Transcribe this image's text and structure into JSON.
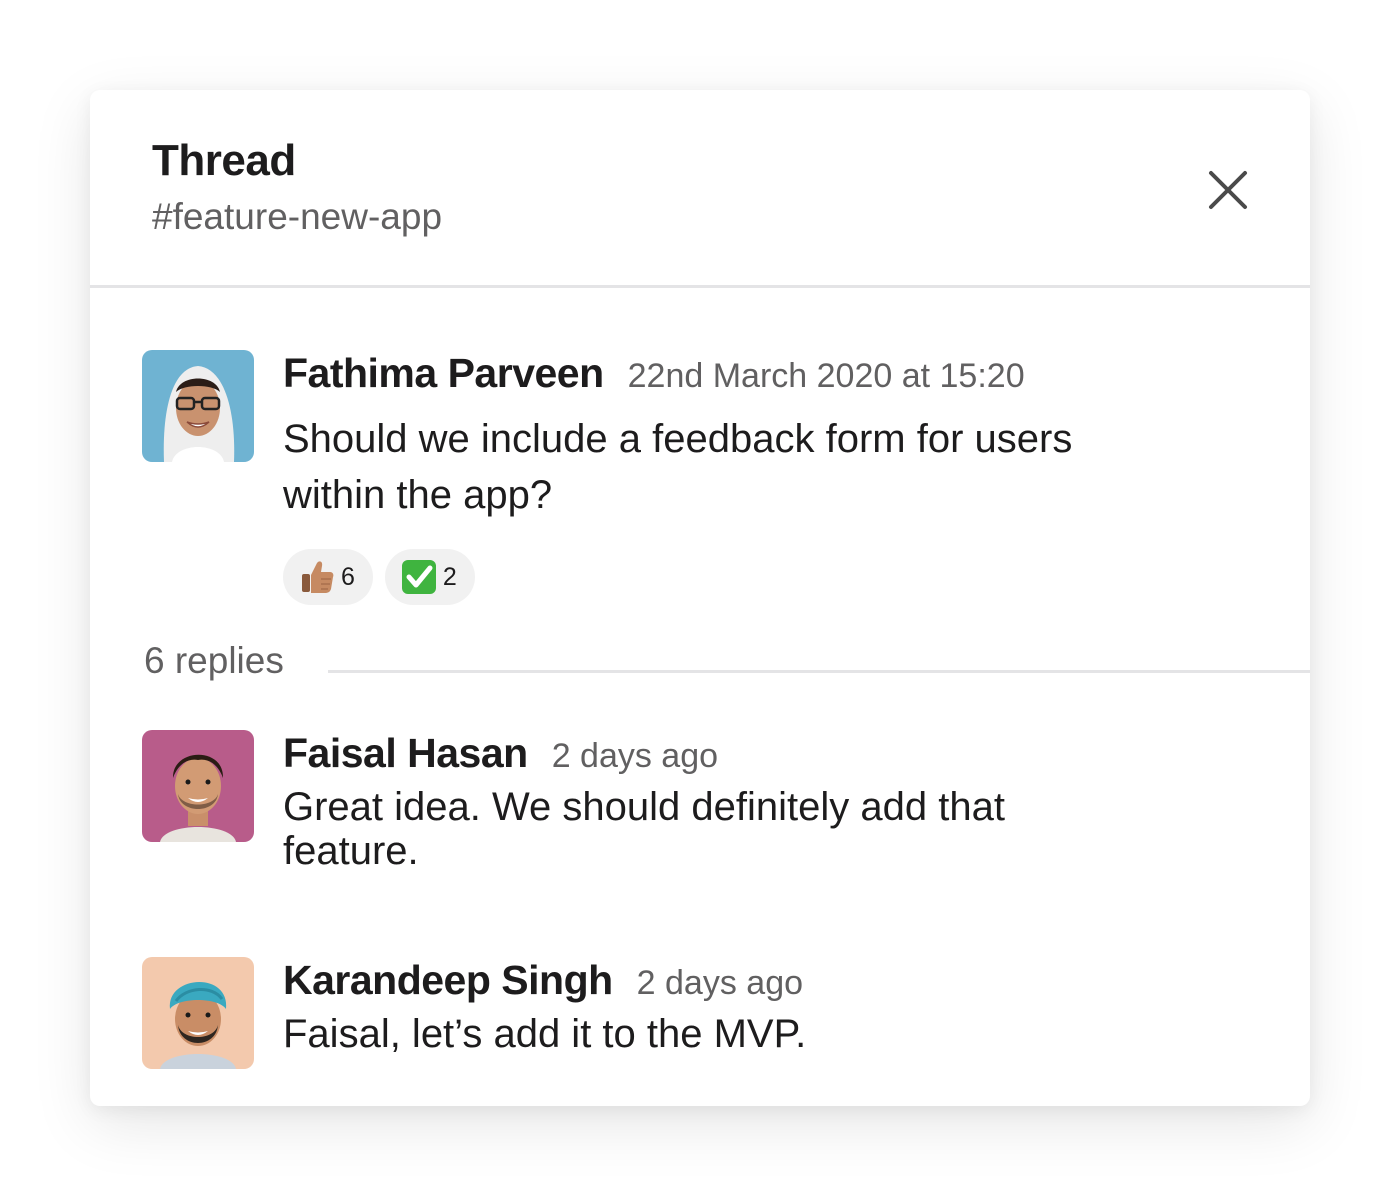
{
  "thread": {
    "title": "Thread",
    "channel": "#feature-new-app",
    "close_icon": "close-icon"
  },
  "parent_message": {
    "author": "Fathima Parveen",
    "timestamp": "22nd March 2020 at 15:20",
    "text_line1": "Should we include a feedback form for users",
    "text_line2": "within the app?",
    "avatar_bg": "#6fb3d2",
    "reactions": [
      {
        "emoji": "thumbs-up",
        "count": "6"
      },
      {
        "emoji": "white-check-mark",
        "count": "2"
      }
    ]
  },
  "replies_label": "6 replies",
  "replies": [
    {
      "author": "Faisal Hasan",
      "timestamp": "2 days ago",
      "text_line1": "Great idea. We should definitely add that",
      "text_line2": "feature.",
      "avatar_bg": "#b85c8a"
    },
    {
      "author": "Karandeep Singh",
      "timestamp": "2 days ago",
      "text_line1": "Faisal, let’s add it to the MVP.",
      "avatar_bg": "#f3c9ad"
    }
  ],
  "colors": {
    "text_primary": "#1d1c1d",
    "text_secondary": "#616061",
    "divider": "#e4e4e6",
    "reaction_bg": "#f1f1f1",
    "check_green": "#3fb43f"
  }
}
